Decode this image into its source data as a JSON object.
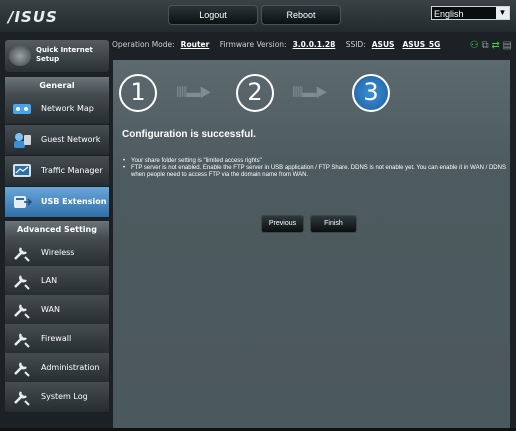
{
  "brand": {
    "logo": "/ISUS"
  },
  "topbar": {
    "logout": "Logout",
    "reboot": "Reboot",
    "language": "English"
  },
  "status": {
    "mode_label": "Operation Mode:",
    "mode_value": "Router",
    "fw_label": "Firmware Version:",
    "fw_value": "3.0.0.1.28",
    "ssid_label": "SSID:",
    "ssid_values": [
      "ASUS",
      "ASUS_5G"
    ]
  },
  "sidebar": {
    "qis": "Quick Internet Setup",
    "general_header": "General",
    "general_items": [
      {
        "label": "Network Map",
        "active": false
      },
      {
        "label": "Guest Network",
        "active": false
      },
      {
        "label": "Traffic Manager",
        "active": false
      },
      {
        "label": "USB Extension",
        "active": true
      }
    ],
    "advanced_header": "Advanced Setting",
    "advanced_items": [
      {
        "label": "Wireless"
      },
      {
        "label": "LAN"
      },
      {
        "label": "WAN"
      },
      {
        "label": "Firewall"
      },
      {
        "label": "Administration"
      },
      {
        "label": "System Log"
      }
    ]
  },
  "wizard": {
    "steps": [
      "1",
      "2",
      "3"
    ],
    "current_step": 3,
    "heading": "Configuration is successful.",
    "bullets": [
      "Your share folder setting is \"limited access rights\"",
      "FTP server is not enabled. Enable the FTP server in USB application / FTP Share. DDNS is not enable yet. You can enable it in WAN / DDNS when people need to access FTP via the domain name from WAN."
    ],
    "previous_label": "Previous",
    "finish_label": "Finish"
  },
  "colors": {
    "accent": "#2f6fa8",
    "panel": "#4e5b60",
    "status_icon_green": "#3bd13b"
  }
}
